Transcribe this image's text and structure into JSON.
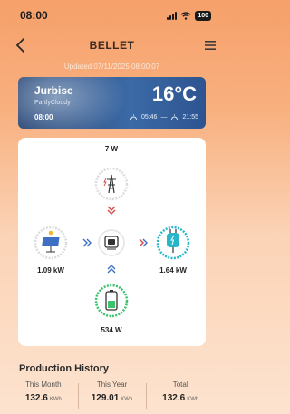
{
  "status": {
    "time": "08:00",
    "battery": "100"
  },
  "nav": {
    "title": "BELLET",
    "back_icon": "chevron-left-icon",
    "menu_icon": "hamburger-menu-icon"
  },
  "updated_text": "Updated 07/11/2025 08:00:07",
  "weather": {
    "city": "Jurbise",
    "condition": "PartlyCloudy",
    "time": "08:00",
    "temperature": "16°C",
    "sunrise": "05:46",
    "sunset": "21:55"
  },
  "energy_flow": {
    "grid": {
      "value": "7 W",
      "icon": "power-tower-icon",
      "color": "#d64a4a"
    },
    "solar": {
      "value": "1.09 kW",
      "icon": "solar-panel-icon",
      "color": "#3f6fc4"
    },
    "inverter": {
      "icon": "inverter-icon"
    },
    "load": {
      "value": "1.64 kW",
      "icon": "charging-plug-icon",
      "color": "#27b6c9"
    },
    "battery": {
      "value": "534 W",
      "icon": "battery-icon",
      "color": "#3cc36b"
    }
  },
  "production": {
    "title": "Production History",
    "items": [
      {
        "label": "This Month",
        "value": "132.6",
        "unit": "KWh"
      },
      {
        "label": "This Year",
        "value": "129.01",
        "unit": "KWh"
      },
      {
        "label": "Total",
        "value": "132.6",
        "unit": "KWh"
      }
    ]
  }
}
